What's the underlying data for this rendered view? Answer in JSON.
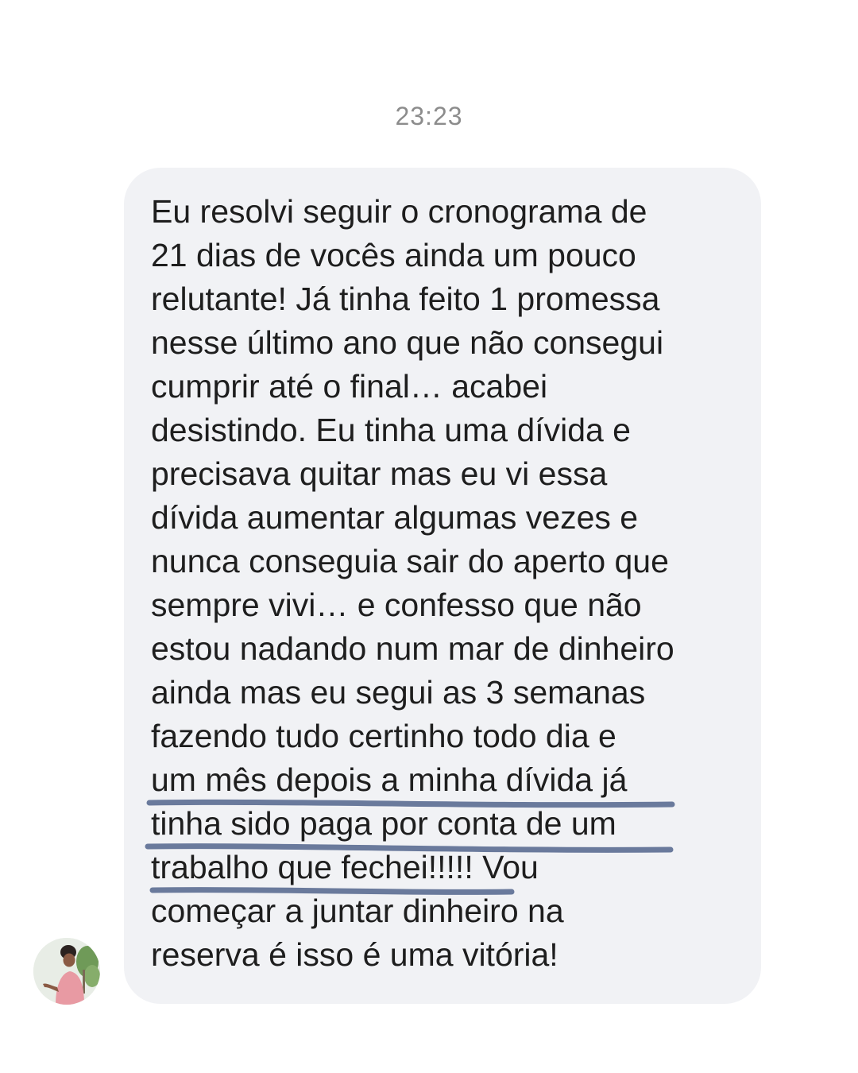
{
  "chat": {
    "timestamp": "23:23",
    "message": {
      "lines": [
        "Eu resolvi seguir o cronograma de",
        "21 dias de vocês ainda um pouco",
        "relutante! Já tinha feito 1 promessa",
        "nesse último ano que não consegui",
        "cumprir até o final… acabei",
        "desistindo. Eu tinha uma dívida e",
        "precisava quitar mas eu vi essa",
        "dívida aumentar algumas vezes e",
        "nunca conseguia sair do aperto que",
        "sempre vivi… e confesso que não",
        "estou nadando num mar de dinheiro",
        "ainda mas eu segui as 3 semanas",
        "fazendo tudo certinho todo dia e",
        "um mês depois a minha dívida já",
        "tinha sido paga por conta de um",
        "trabalho que fechei!!!!! Vou",
        "começar a juntar dinheiro na",
        "reserva é isso é uma vitória!"
      ],
      "underline_color": "#6a7a9c"
    }
  }
}
